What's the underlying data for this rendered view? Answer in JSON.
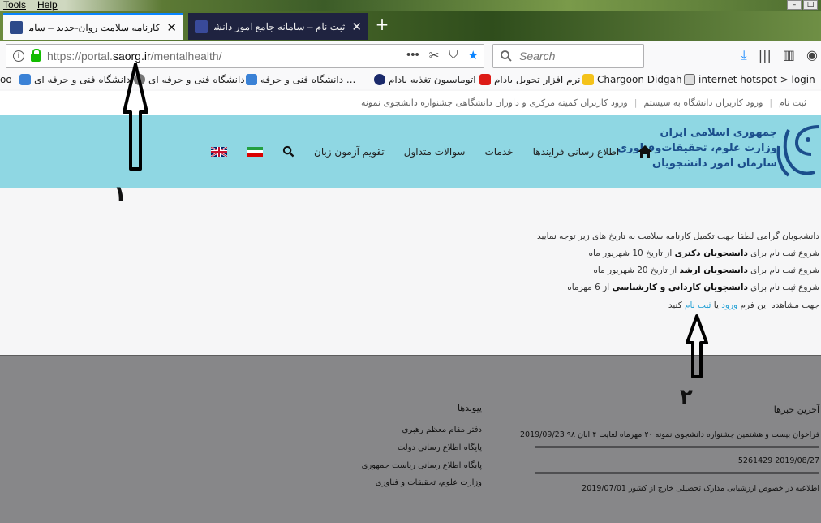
{
  "menubar": {
    "items": [
      "Tools",
      "Help"
    ]
  },
  "tabs": [
    {
      "title": "کارنامه سلامت روان-جدید – سامانه",
      "active": true
    },
    {
      "title": "ثبت نام – سامانه جامع امور دانشجوی",
      "active": false
    }
  ],
  "url": {
    "prefix": "https://portal.",
    "domain": "saorg.ir",
    "path": "/mentalhealth/"
  },
  "search": {
    "placeholder": "Search"
  },
  "bookmarks": [
    "internet hotspot > login",
    "Chargoon Didgah",
    "نرم افزار تحویل بادام",
    "اتوماسیون تغذیه بادام",
    "دانشگاه فنی و حرفه ...",
    "دانشگاه فنی و حرفه ای",
    "دانشگاه فنی و حرفه ای",
    "oo"
  ],
  "top_links": [
    "ثبت نام",
    "ورود کاربران دانشگاه به سیستم",
    "ورود کاربران کمیته مرکزی و داوران دانشگاهی جشنواره دانشجوی نمونه"
  ],
  "brand": {
    "line1": "جمهوری اسلامی ایران",
    "line2": "وزارت علوم، تحقیقات‌وفناوری",
    "line3": "سازمان امور دانشجویان"
  },
  "nav": {
    "items": [
      "اطلاع رسانی فرایندها",
      "خدمات",
      "سوالات متداول",
      "تقویم آزمون زبان"
    ]
  },
  "content": {
    "intro": "دانشجویان گرامی لطفا جهت تکمیل کارنامه سلامت به تاریخ های زیر توجه نمایید",
    "lines": [
      {
        "pre": "شروع ثبت نام برای ",
        "bold": "دانشجویان دکتری",
        "post": " از تاریخ 10 شهریور ماه"
      },
      {
        "pre": "شروع ثبت نام برای ",
        "bold": "دانشجویان ارشد",
        "post": " از تاریخ 20 شهریور ماه"
      },
      {
        "pre": "شروع ثبت نام برای ",
        "bold": "دانشجویان کاردانی و کارشناسی",
        "post": " از 6 مهرماه"
      }
    ],
    "cta": {
      "pre": "جهت مشاهده این فرم ",
      "login": "ورود",
      "or": " یا ",
      "register": "ثبت نام",
      "post": " کنید"
    }
  },
  "footer": {
    "news_title": "آخرین خبرها",
    "news": [
      "فراخوان بیست و هشتمین جشنواره دانشجوی نمونه ۲۰ مهرماه لغایت ۴ آبان ۹۸ 2019/09/23",
      "2019/08/27 5261429",
      "اطلاعیه در خصوص ارزشیابی مدارک تحصیلی خارج از کشور 2019/07/01"
    ],
    "links_title": "پیوندها",
    "links": [
      "دفتر مقام معظم رهبری",
      "پایگاه اطلاع رسانی دولت",
      "پایگاه اطلاع رسانی ریاست جمهوری",
      "وزارت علوم، تحقیقات و فناوری"
    ]
  },
  "annotations": {
    "label1": "۱",
    "label2": "۲"
  }
}
